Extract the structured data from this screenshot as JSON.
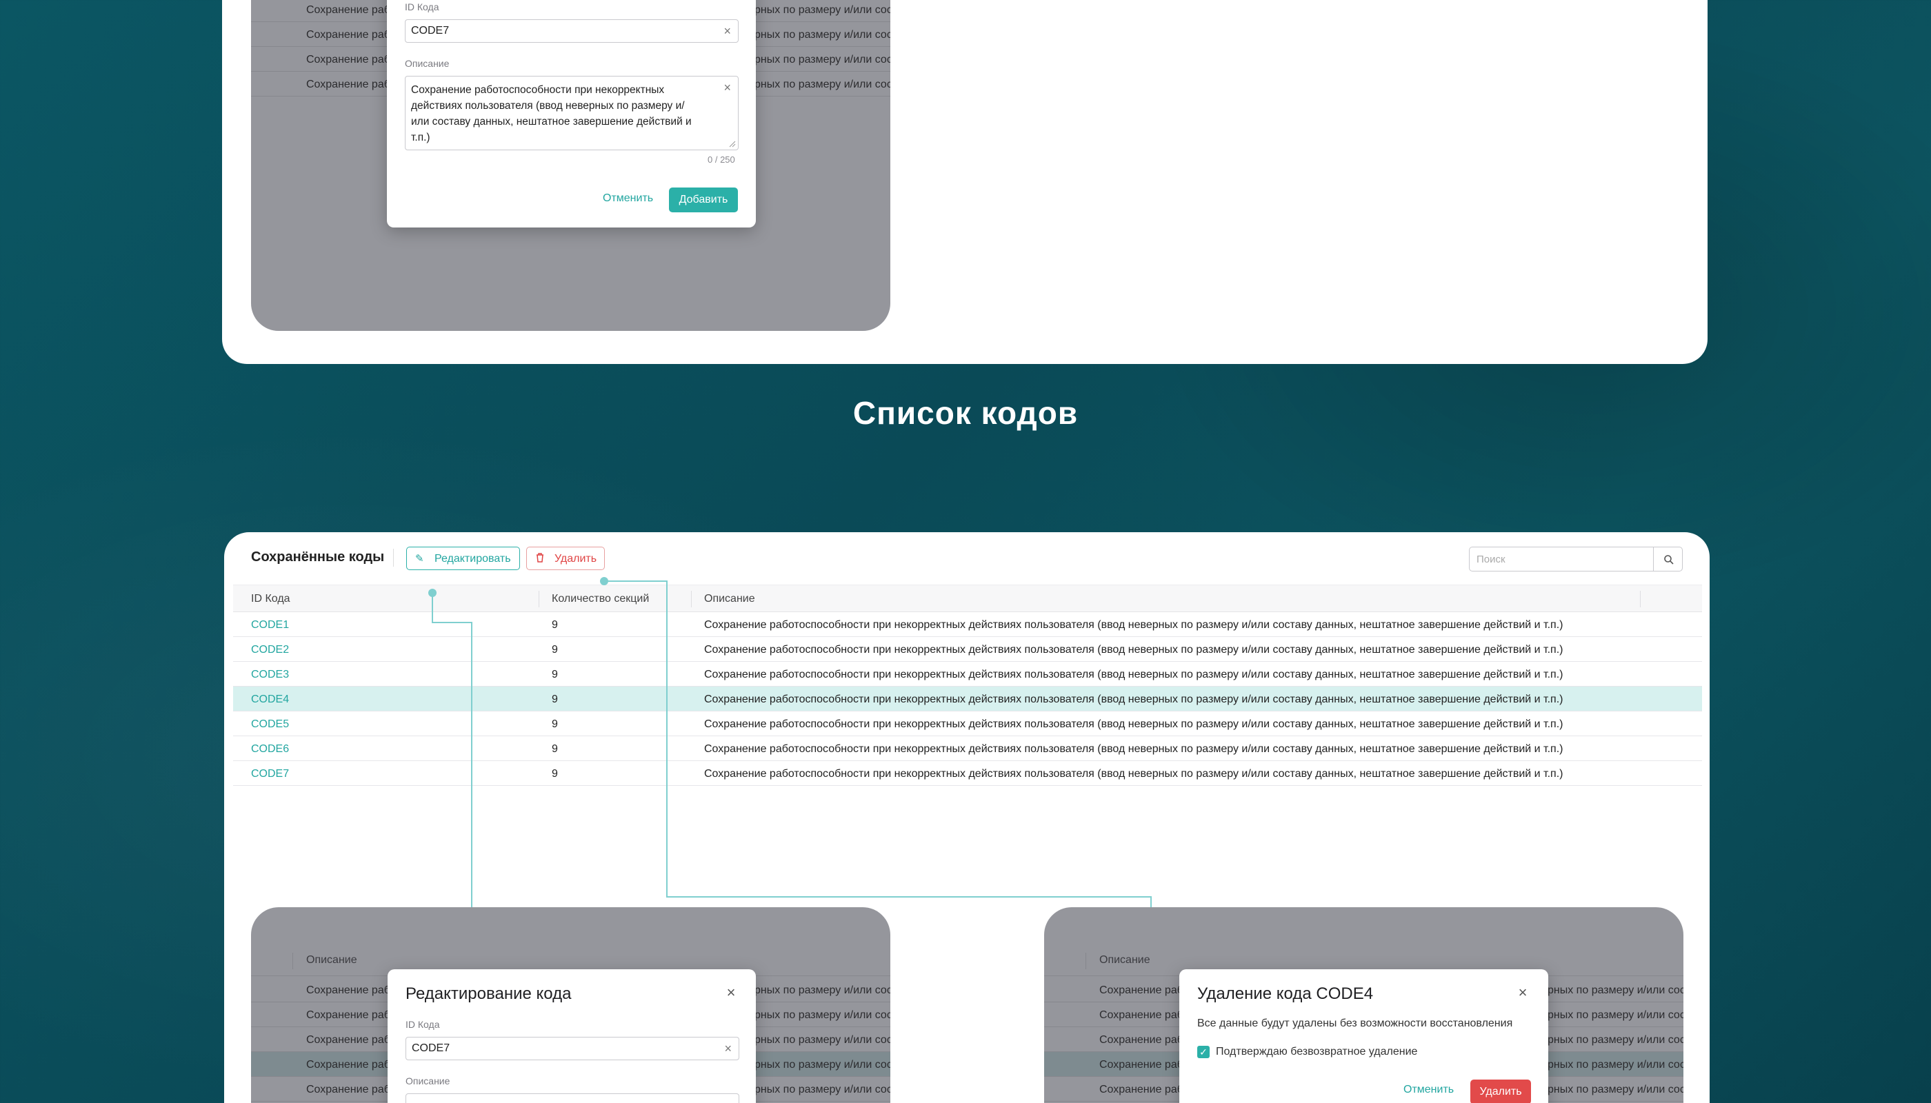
{
  "section_title": "Список кодов",
  "add_preview": {
    "code_label": "ID Кода",
    "code_value": "CODE7",
    "description_label": "Описание",
    "description_value": "Сохранение работоспособности при некорректных действиях пользователя (ввод неверных по размеру и/или составу данных, нештатное завершение действий и т.п.)",
    "counter": "0 / 250",
    "cancel_label": "Отменить",
    "submit_label": "Добавить",
    "bg_row_left": "Сохранение раб",
    "bg_row_right": "рных по размеру и/или сос"
  },
  "toolbar": {
    "title": "Сохранённые коды",
    "edit_label": "Редактировать",
    "delete_label": "Удалить",
    "search_placeholder": "Поиск"
  },
  "table": {
    "columns": [
      "ID Кода",
      "Количество секций",
      "Описание"
    ],
    "rows": [
      {
        "id": "CODE1",
        "count": "9",
        "desc": "Сохранение работоспособности при некорректных действиях пользователя (ввод неверных по размеру и/или составу данных, нештатное завершение действий и т.п.)"
      },
      {
        "id": "CODE2",
        "count": "9",
        "desc": "Сохранение работоспособности при некорректных действиях пользователя (ввод неверных по размеру и/или составу данных, нештатное завершение действий и т.п.)"
      },
      {
        "id": "CODE3",
        "count": "9",
        "desc": "Сохранение работоспособности при некорректных действиях пользователя (ввод неверных по размеру и/или составу данных, нештатное завершение действий и т.п.)"
      },
      {
        "id": "CODE4",
        "count": "9",
        "desc": "Сохранение работоспособности при некорректных действиях пользователя (ввод неверных по размеру и/или составу данных, нештатное завершение действий и т.п.)"
      },
      {
        "id": "CODE5",
        "count": "9",
        "desc": "Сохранение работоспособности при некорректных действиях пользователя (ввод неверных по размеру и/или составу данных, нештатное завершение действий и т.п.)"
      },
      {
        "id": "CODE6",
        "count": "9",
        "desc": "Сохранение работоспособности при некорректных действиях пользователя (ввод неверных по размеру и/или составу данных, нештатное завершение действий и т.п.)"
      },
      {
        "id": "CODE7",
        "count": "9",
        "desc": "Сохранение работоспособности при некорректных действиях пользователя (ввод неверных по размеру и/или составу данных, нештатное завершение действий и т.п.)"
      }
    ],
    "selected_row": "CODE4"
  },
  "edit_preview": {
    "header_label": "Описание",
    "title": "Редактирование кода",
    "code_label": "ID Кода",
    "code_value": "CODE7",
    "description_label": "Описание",
    "bg_row_left": "Сохранение раб",
    "bg_row_right": "рных по размеру и/или сос"
  },
  "delete_preview": {
    "header_label": "Описание",
    "title": "Удаление кода CODE4",
    "message": "Все данные будут удалены без возможности восстановления",
    "checkbox_label": "Подтверждаю безвозвратное удаление",
    "checkbox_checked": true,
    "cancel_label": "Отменить",
    "delete_label": "Удалить",
    "bg_row_left": "Сохранение раб",
    "bg_row_right": "рных по размеру и/или сос"
  },
  "colors": {
    "accent": "#2bb0a8",
    "danger": "#e24a4a",
    "selected_row": "#d7f1ef",
    "background": "#0b5663"
  }
}
